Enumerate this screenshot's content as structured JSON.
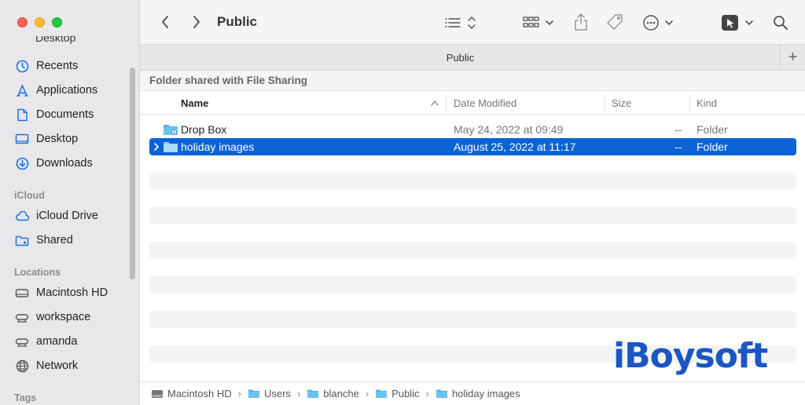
{
  "window": {
    "title": "Public"
  },
  "sidebar": {
    "partial_item": "Desktop",
    "favorites": [
      {
        "label": "Recents",
        "icon": "clock-icon"
      },
      {
        "label": "Applications",
        "icon": "applications-icon"
      },
      {
        "label": "Documents",
        "icon": "document-icon"
      },
      {
        "label": "Desktop",
        "icon": "desktop-icon"
      },
      {
        "label": "Downloads",
        "icon": "download-icon"
      }
    ],
    "icloud_header": "iCloud",
    "icloud": [
      {
        "label": "iCloud Drive",
        "icon": "cloud-icon"
      },
      {
        "label": "Shared",
        "icon": "shared-folder-icon"
      }
    ],
    "locations_header": "Locations",
    "locations": [
      {
        "label": "Macintosh HD",
        "icon": "disk-icon"
      },
      {
        "label": "workspace",
        "icon": "network-drive-icon"
      },
      {
        "label": "amanda",
        "icon": "network-drive-icon"
      },
      {
        "label": "Network",
        "icon": "globe-icon"
      }
    ],
    "tags_header": "Tags"
  },
  "tab": {
    "label": "Public",
    "add": "+"
  },
  "banner": "Folder shared with File Sharing",
  "columns": {
    "name": "Name",
    "date": "Date Modified",
    "size": "Size",
    "kind": "Kind"
  },
  "files": [
    {
      "name": "Drop Box",
      "date": "May 24, 2022 at 09:49",
      "size": "--",
      "kind": "Folder",
      "selected": false
    },
    {
      "name": "holiday images",
      "date": "August 25, 2022 at 11:17",
      "size": "--",
      "kind": "Folder",
      "selected": true
    }
  ],
  "pathbar": [
    "Macintosh HD",
    "Users",
    "blanche",
    "Public",
    "holiday images"
  ],
  "watermark": "iBoysoft",
  "colors": {
    "accent": "#0b63d6",
    "folder": "#5ab0e8"
  }
}
